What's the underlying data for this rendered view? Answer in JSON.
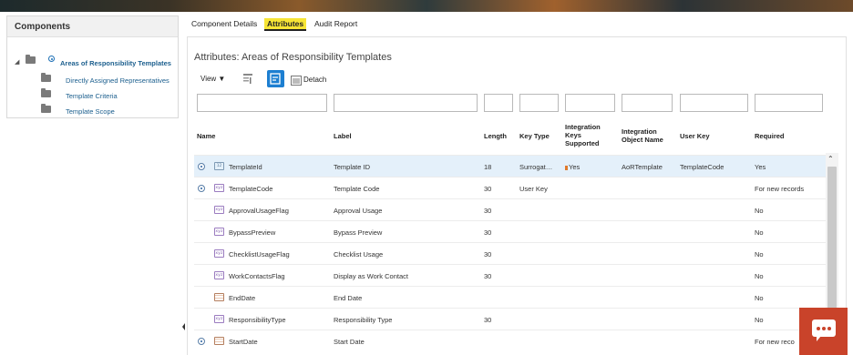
{
  "left_panel": {
    "title": "Components",
    "tree": [
      {
        "label": "Areas of Responsibility Templates",
        "selected": true
      },
      {
        "label": "Directly Assigned Representatives"
      },
      {
        "label": "Template Criteria"
      },
      {
        "label": "Template Scope"
      }
    ]
  },
  "tabs": [
    {
      "label": "Component Details"
    },
    {
      "label": "Attributes",
      "active": true
    },
    {
      "label": "Audit Report"
    }
  ],
  "main": {
    "title": "Attributes: Areas of Responsibility Templates",
    "view_label": "View ▼",
    "detach_label": "Detach"
  },
  "table": {
    "headers": {
      "name": "Name",
      "label": "Label",
      "length": "Length",
      "key_type": "Key Type",
      "integration_keys": [
        "Integration",
        "Keys",
        "Supported"
      ],
      "integration_object": [
        "Integration",
        "Object Name"
      ],
      "user_key": "User Key",
      "required": "Required"
    },
    "rows": [
      {
        "radio": true,
        "icon": "number-icon",
        "icon_text": "12",
        "name": "TemplateId",
        "label": "Template ID",
        "length": "18",
        "key_type": "Surrogat…",
        "integration_keys": "Yes",
        "integration_object": "AoRTemplate",
        "user_key": "TemplateCode",
        "required": "Yes"
      },
      {
        "radio": true,
        "icon": "text-icon",
        "icon_text": "xyz",
        "name": "TemplateCode",
        "label": "Template Code",
        "length": "30",
        "key_type": "User Key",
        "integration_keys": "",
        "integration_object": "",
        "user_key": "",
        "required": "For new records"
      },
      {
        "radio": false,
        "icon": "text-icon",
        "icon_text": "xyz",
        "name": "ApprovalUsageFlag",
        "label": "Approval Usage",
        "length": "30",
        "key_type": "",
        "integration_keys": "",
        "integration_object": "",
        "user_key": "",
        "required": "No"
      },
      {
        "radio": false,
        "icon": "text-icon",
        "icon_text": "xyz",
        "name": "BypassPreview",
        "label": "Bypass Preview",
        "length": "30",
        "key_type": "",
        "integration_keys": "",
        "integration_object": "",
        "user_key": "",
        "required": "No"
      },
      {
        "radio": false,
        "icon": "text-icon",
        "icon_text": "xyz",
        "name": "ChecklistUsageFlag",
        "label": "Checklist Usage",
        "length": "30",
        "key_type": "",
        "integration_keys": "",
        "integration_object": "",
        "user_key": "",
        "required": "No"
      },
      {
        "radio": false,
        "icon": "text-icon",
        "icon_text": "xyz",
        "name": "WorkContactsFlag",
        "label": "Display as Work Contact",
        "length": "30",
        "key_type": "",
        "integration_keys": "",
        "integration_object": "",
        "user_key": "",
        "required": "No"
      },
      {
        "radio": false,
        "icon": "date-icon",
        "icon_text": "",
        "name": "EndDate",
        "label": "End Date",
        "length": "",
        "key_type": "",
        "integration_keys": "",
        "integration_object": "",
        "user_key": "",
        "required": "No"
      },
      {
        "radio": false,
        "icon": "text-icon",
        "icon_text": "xyz",
        "name": "ResponsibilityType",
        "label": "Responsibility Type",
        "length": "30",
        "key_type": "",
        "integration_keys": "",
        "integration_object": "",
        "user_key": "",
        "required": "No"
      },
      {
        "radio": true,
        "icon": "date-icon",
        "icon_text": "",
        "name": "StartDate",
        "label": "Start Date",
        "length": "",
        "key_type": "",
        "integration_keys": "",
        "integration_object": "",
        "user_key": "",
        "required": "For new reco"
      }
    ]
  }
}
